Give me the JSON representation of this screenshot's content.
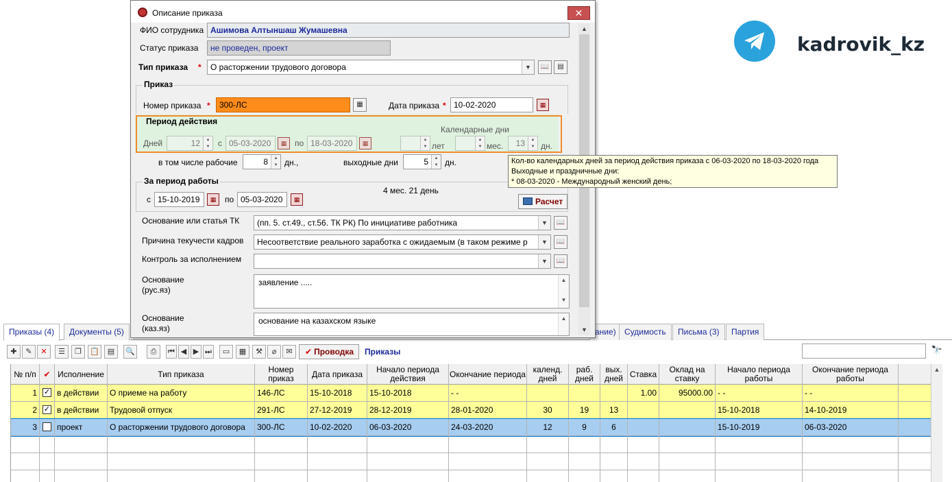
{
  "brand": {
    "name": "kadrovik_kz",
    "icon": "telegram-icon",
    "color": "#2aa2dc"
  },
  "tabs": [
    {
      "label": "Приказы (4)",
      "active": true
    },
    {
      "label": "Документы (5)"
    },
    {
      "label": "ание)"
    },
    {
      "label": "Судимость"
    },
    {
      "label": "Письма (3)"
    },
    {
      "label": "Партия"
    }
  ],
  "toolbar": {
    "post_label": "Проводка",
    "title": "Приказы"
  },
  "grid": {
    "headers": [
      "№ п/п",
      "✔",
      "Исполнение",
      "Тип приказа",
      "Номер приказ",
      "Дата приказа",
      "Начало периода действия",
      "Окончание периода",
      "календ. дней",
      "раб. дней",
      "вых. дней",
      "Ставка",
      "Оклад на ставку",
      "Начало периода работы",
      "Окончание периода работы"
    ],
    "rows": [
      {
        "n": "1",
        "checked": true,
        "status": "в действии",
        "type": "О приеме на работу",
        "num": "146-ЛС",
        "date": "15-10-2018",
        "start": "15-10-2018",
        "end": "- -",
        "cal": "",
        "work": "",
        "off": "",
        "rate": "1.00",
        "salary": "95000.00",
        "wstart": "- -",
        "wend": "- -",
        "style": "yellow"
      },
      {
        "n": "2",
        "checked": true,
        "status": "в действии",
        "type": "Трудовой отпуск",
        "num": "291-ЛС",
        "date": "27-12-2019",
        "start": "28-12-2019",
        "end": "28-01-2020",
        "cal": "30",
        "work": "19",
        "off": "13",
        "rate": "",
        "salary": "",
        "wstart": "15-10-2018",
        "wend": "14-10-2019",
        "style": "yellow"
      },
      {
        "n": "3",
        "checked": false,
        "status": "проект",
        "type": "О расторжении трудового договора",
        "num": "300-ЛС",
        "date": "10-02-2020",
        "start": "06-03-2020",
        "end": "24-03-2020",
        "cal": "12",
        "work": "9",
        "off": "6",
        "rate": "",
        "salary": "",
        "wstart": "15-10-2019",
        "wend": "06-03-2020",
        "style": "selected"
      }
    ]
  },
  "dialog": {
    "title": "Описание приказа",
    "fio_label": "ФИО сотрудника",
    "fio_value": "Ашимова Алтыншаш Жумашевна",
    "status_label": "Статус приказа",
    "status_value": "не проведен, проект",
    "type_label": "Тип приказа",
    "type_value": "О расторжении трудового договора",
    "order_group": "Приказ",
    "number_label": "Номер приказа",
    "number_value": "300-ЛС",
    "date_label": "Дата приказа",
    "date_value": "10-02-2020",
    "period_group": "Период действия",
    "calendar_days_label": "Календарные дни",
    "days_label": "Дней",
    "days_value": "12",
    "from_label": "с",
    "from_value": "05-03-2020",
    "to_label": "по",
    "to_value": "18-03-2020",
    "years_label": "лет",
    "years_value": "",
    "months_label": "мес.",
    "months_value": "",
    "dn_label": "дн.",
    "dn_value": "13",
    "workdays_label": "в том числе рабочие",
    "workdays_value": "8",
    "workdays_unit": "дн.,",
    "offdays_label": "выходные дни",
    "offdays_value": "5",
    "offdays_unit": "дн.",
    "work_period_group": "За период работы",
    "wp_from_label": "с",
    "wp_from_value": "15-10-2019",
    "wp_to_label": "по",
    "wp_to_value": "05-03-2020",
    "wp_duration": "4 мес. 21 день",
    "calc_label": "Расчет",
    "basis_label": "Основание или статья ТК",
    "basis_value": "(пп. 5. ст.49., ст.56. ТК РК) По инициативе работника",
    "reason_label": "Причина текучести кадров",
    "reason_value": "Несоответствие реального заработка с ожидаемым (в таком режиме р",
    "control_label": "Контроль за исполнением",
    "control_value": "",
    "basis_ru_label1": "Основание",
    "basis_ru_label2": "(рус.яз)",
    "basis_ru_value": "заявление .....",
    "basis_kz_label1": "Основание",
    "basis_kz_label2": "(каз.яз)",
    "basis_kz_value": "основание на казахском языке"
  },
  "tooltip": {
    "line1": "Кол-во календарных дней за период действия приказа с 06-03-2020 по 18-03-2020 года",
    "line2": "Выходные и праздничные дни:",
    "line3": "* 08-03-2020 - Международный женский день;"
  }
}
